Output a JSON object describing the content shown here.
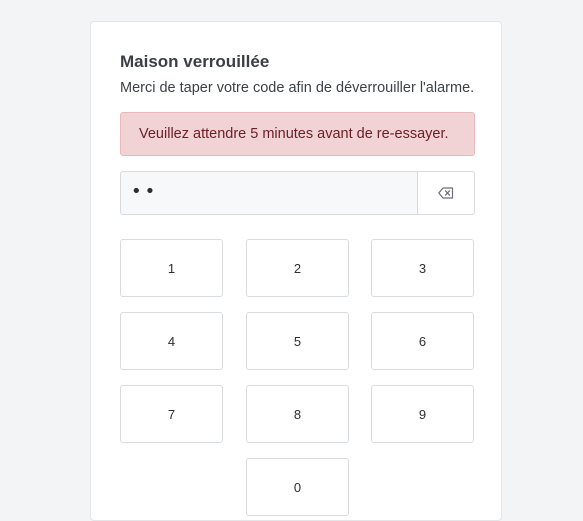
{
  "lock": {
    "title": "Maison verrouillée",
    "subtitle": "Merci de taper votre code afin de déverrouiller l'alarme.",
    "alert": "Veuillez attendre 5 minutes avant de re-essayer.",
    "code_value": "••"
  },
  "keypad": {
    "keys": [
      "1",
      "2",
      "3",
      "4",
      "5",
      "6",
      "7",
      "8",
      "9",
      "0"
    ]
  },
  "icons": {
    "backspace": "backspace-icon"
  },
  "colors": {
    "alert_bg": "#f2d3d5",
    "alert_text": "#6a1e25",
    "card_bg": "#ffffff",
    "page_bg": "#f3f4f6"
  }
}
